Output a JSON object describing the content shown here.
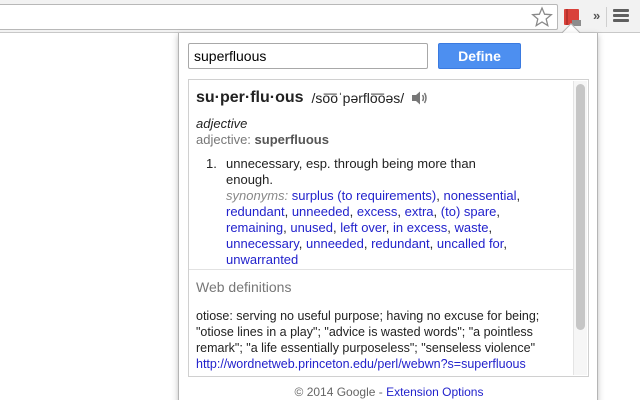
{
  "popup": {
    "search": {
      "value": "superfluous"
    },
    "define_label": "Define",
    "entry": {
      "headword": "su·per·flu·ous",
      "pronunciation": "/so͞oˈpərflo͞oəs/",
      "pos_italic": "adjective",
      "pos_label": "adjective:",
      "pos_word": "superfluous",
      "sense_number": "1.",
      "definition": "unnecessary, esp. through being more than enough.",
      "synonyms_label": "synonyms:",
      "synonyms": [
        "surplus (to requirements)",
        "nonessential",
        "redundant",
        "unneeded",
        "excess",
        "extra",
        "(to) spare",
        "remaining",
        "unused",
        "left over",
        "in excess",
        "waste",
        "unnecessary",
        "unneeded",
        "redundant",
        "uncalled for",
        "unwarranted"
      ]
    },
    "web": {
      "heading": "Web definitions",
      "text": "otiose: serving no useful purpose; having no excuse for being; \"otiose lines in a play\"; \"advice is wasted words\"; \"a pointless remark\"; \"a life essentially purposeless\"; \"senseless violence\"",
      "url": "http://wordnetweb.princeton.edu/perl/webwn?s=superfluous"
    },
    "footer": {
      "copyright": "© 2014 Google - ",
      "options_label": "Extension Options"
    }
  },
  "icons": {
    "star": "star-icon",
    "extension": "dictionary-extension-icon",
    "menu": "menu-icon",
    "speaker": "speaker-icon"
  },
  "colors": {
    "accent": "#4d8ff0",
    "link": "#2222cc",
    "extension_red": "#d9413a"
  }
}
